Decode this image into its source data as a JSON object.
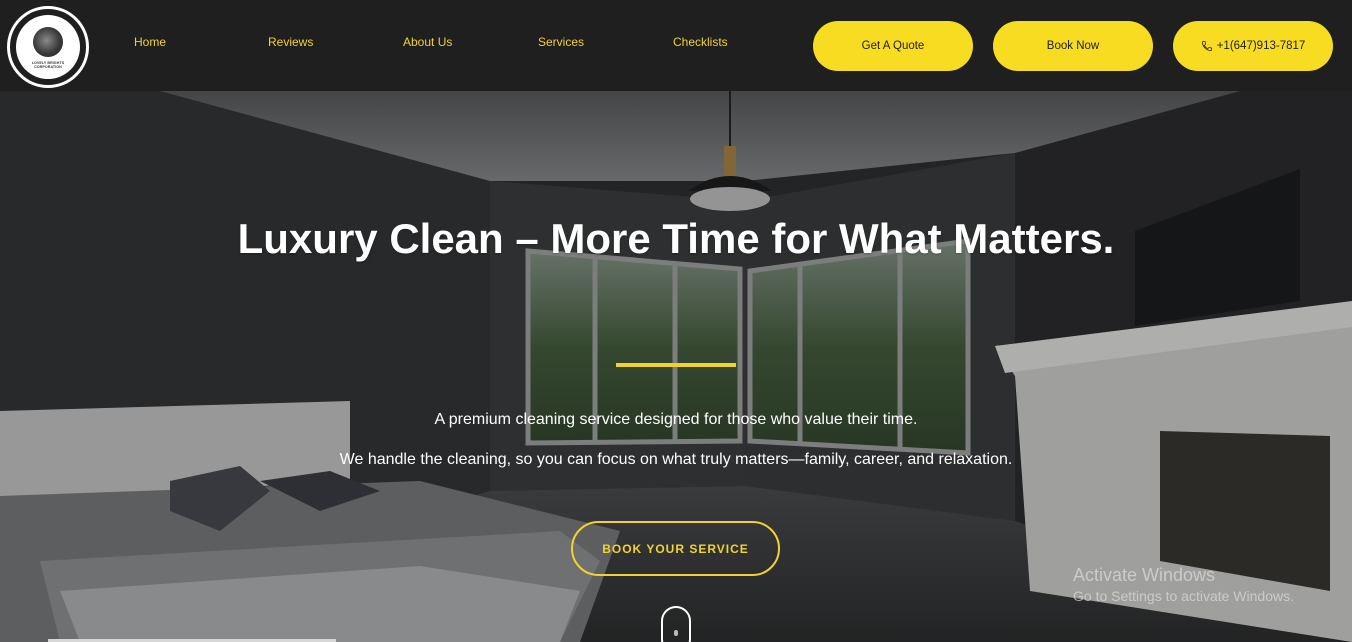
{
  "header": {
    "logo_text": "LOVELY BRIGHTS CORPORATION",
    "nav": [
      {
        "label": "Home"
      },
      {
        "label": "Reviews"
      },
      {
        "label": "About Us"
      },
      {
        "label": "Services"
      },
      {
        "label": "Checklists"
      }
    ],
    "buttons": {
      "quote": "Get A Quote",
      "book": "Book Now",
      "phone": "+1(647)913-7817"
    }
  },
  "hero": {
    "title": "Luxury Clean – More Time for What Matters.",
    "subtitle1": "A premium cleaning service designed for those who value their time.",
    "subtitle2": "We handle the cleaning, so you can focus on what truly matters—family, career, and relaxation.",
    "cta": "BOOK YOUR SERVICE"
  },
  "watermark": {
    "line1": "Activate Windows",
    "line2": "Go to Settings to activate Windows."
  },
  "colors": {
    "accent": "#f8dc22",
    "header_bg": "#1f1f1f"
  }
}
